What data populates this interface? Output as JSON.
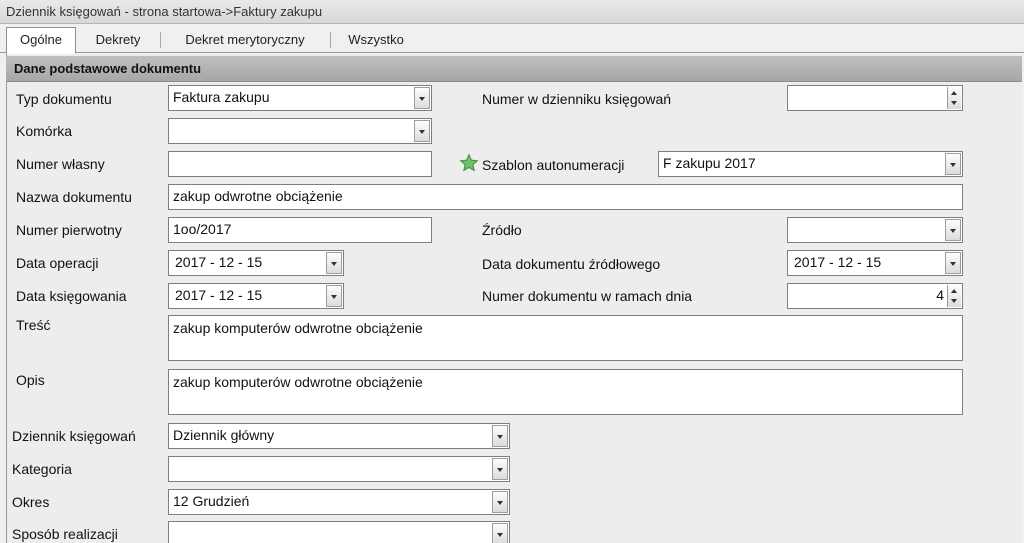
{
  "window": {
    "title": "Dziennik księgowań - strona startowa->Faktury zakupu"
  },
  "tabs": [
    {
      "label": "Ogólne",
      "active": true
    },
    {
      "label": "Dekrety",
      "active": false
    },
    {
      "label": "Dekret merytoryczny",
      "active": false
    },
    {
      "label": "Wszystko",
      "active": false
    }
  ],
  "section": {
    "title": "Dane podstawowe dokumentu"
  },
  "form": {
    "typ_dokumentu": {
      "label": "Typ dokumentu",
      "value": "Faktura zakupu"
    },
    "komorka": {
      "label": "Komórka",
      "value": ""
    },
    "numer_wlasny": {
      "label": "Numer własny",
      "value": ""
    },
    "nazwa_dokumentu": {
      "label": "Nazwa dokumentu",
      "value": "zakup odwrotne obciążenie"
    },
    "numer_pierwotny": {
      "label": "Numer pierwotny",
      "value": "1oo/2017"
    },
    "data_operacji": {
      "label": "Data operacji",
      "value": "2017 - 12 - 15"
    },
    "data_ksiegowania": {
      "label": "Data księgowania",
      "value": "2017 - 12 - 15"
    },
    "tresc": {
      "label": "Treść",
      "value": "zakup komputerów odwrotne obciążenie"
    },
    "opis": {
      "label": "Opis",
      "value": "zakup komputerów odwrotne obciążenie"
    },
    "dziennik": {
      "label": "Dziennik księgowań",
      "value": "Dziennik główny"
    },
    "kategoria": {
      "label": "Kategoria",
      "value": ""
    },
    "okres": {
      "label": "Okres",
      "value": "12 Grudzień"
    },
    "sposob_realizacji": {
      "label": "Sposób realizacji",
      "value": ""
    },
    "numer_w_dzienniku": {
      "label": "Numer w dzienniku księgowań",
      "value": ""
    },
    "szablon": {
      "label": "Szablon autonumeracji",
      "value": "F zakupu 2017",
      "icon": "star-icon",
      "icon_color": "#5cb85c"
    },
    "zrodlo": {
      "label": "Źródło",
      "value": ""
    },
    "data_dokumentu_zrodlowego": {
      "label": "Data dokumentu źródłowego",
      "value": "2017 - 12 - 15"
    },
    "numer_dokumentu_w_dniu": {
      "label": "Numer dokumentu w ramach dnia",
      "value": "4"
    }
  }
}
